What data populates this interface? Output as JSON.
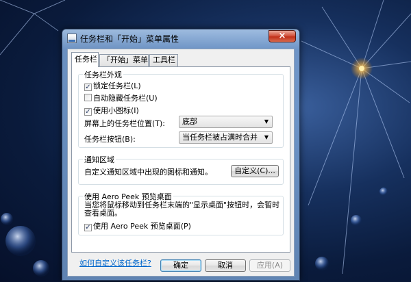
{
  "window": {
    "title": "任务栏和「开始」菜单属性",
    "close_symbol": "×"
  },
  "tabs": [
    {
      "label": "任务栏",
      "active": true
    },
    {
      "label": "「开始」菜单",
      "active": false
    },
    {
      "label": "工具栏",
      "active": false
    }
  ],
  "appearance": {
    "heading": "任务栏外观",
    "lock": {
      "label": "锁定任务栏(L)",
      "checked": true,
      "mark": "✓"
    },
    "autohide": {
      "label": "自动隐藏任务栏(U)",
      "checked": false
    },
    "small_icons": {
      "label": "使用小图标(I)",
      "checked": true,
      "mark": "✓"
    },
    "location_label": "屏幕上的任务栏位置(T):",
    "location_value": "底部",
    "buttons_label": "任务栏按钮(B):",
    "buttons_value": "当任务栏被占满时合并"
  },
  "notification": {
    "heading": "通知区域",
    "description": "自定义通知区域中出现的图标和通知。",
    "customize_button": "自定义(C)..."
  },
  "aero_peek": {
    "heading": "使用 Aero Peek 预览桌面",
    "description_1": "当您将鼠标移动到任务栏末端的\"显示桌面\"按钮时，会暂时",
    "description_2": "查看桌面。",
    "checkbox": {
      "label": "使用 Aero Peek 预览桌面(P)",
      "checked": true,
      "mark": "✓"
    }
  },
  "help_link": "如何自定义该任务栏?",
  "footer": {
    "ok": "确定",
    "cancel": "取消",
    "apply": "应用(A)"
  },
  "dropdown_arrow": "▼",
  "colors": {
    "link": "#0066cc",
    "window_frame": "#2b3f5e",
    "close_button": "#c1301a"
  }
}
